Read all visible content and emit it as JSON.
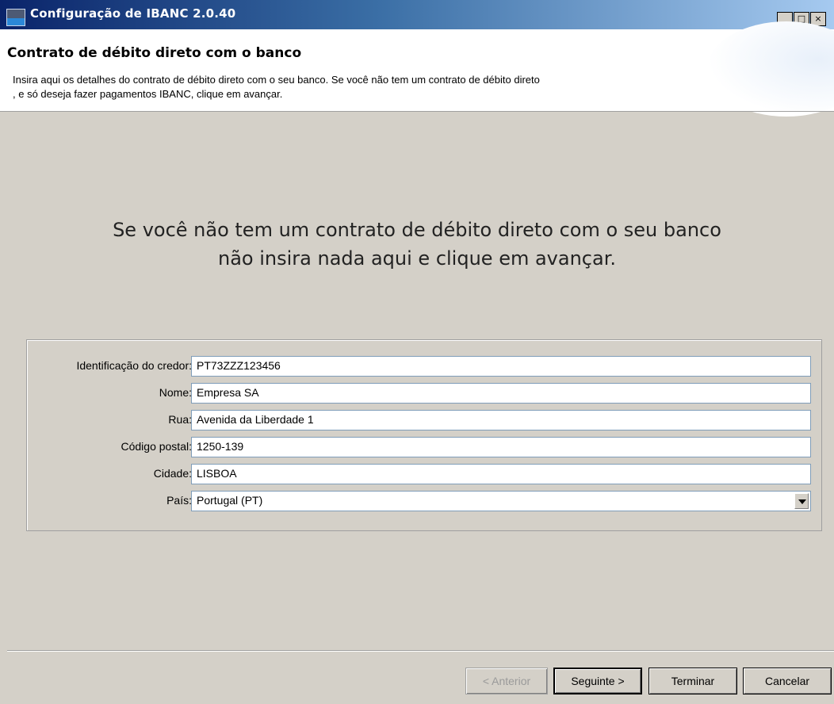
{
  "window": {
    "title": "Configuração de IBANC 2.0.40",
    "controls": [
      "_",
      "□",
      "×"
    ]
  },
  "header": {
    "title": "Contrato de débito direto com o banco",
    "description_line1": "Insira aqui os detalhes do contrato de débito direto com o seu banco. Se você não tem um contrato de débito direto",
    "description_line2": ", e só deseja fazer pagamentos IBANC, clique em avançar."
  },
  "note": {
    "line1": "Se você não tem um contrato de débito direto com o seu banco",
    "line2": "não insira nada aqui e clique em avançar."
  },
  "form": {
    "creditor_id": {
      "label": "Identificação do credor:",
      "value": "PT73ZZZ123456"
    },
    "name": {
      "label": "Nome:",
      "value": "Empresa SA"
    },
    "street": {
      "label": "Rua:",
      "value": "Avenida da Liberdade 1"
    },
    "postal_code": {
      "label": "Código postal:",
      "value": "1250-139"
    },
    "city": {
      "label": "Cidade:",
      "value": "LISBOA"
    },
    "country": {
      "label": "País:",
      "value": "Portugal (PT)"
    }
  },
  "buttons": {
    "previous": "< Anterior",
    "next": "Seguinte >",
    "finish": "Terminar",
    "cancel": "Cancelar"
  },
  "icons": {
    "app": "app-icon",
    "dropdown": "chevron-down-icon"
  }
}
